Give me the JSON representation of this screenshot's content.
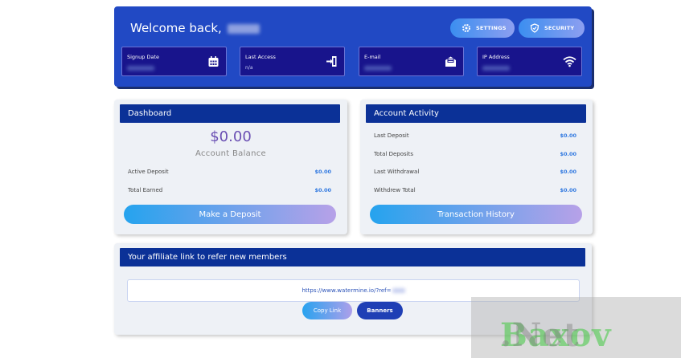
{
  "header": {
    "welcome": "Welcome back,",
    "settings_label": "SETTINGS",
    "security_label": "SECURITY",
    "signup_date_label": "Signup Date",
    "last_access_label": "Last Access",
    "last_access_value": "n/a",
    "email_label": "E-mail",
    "ip_label": "IP Address"
  },
  "dashboard": {
    "title": "Dashboard",
    "balance": "$0.00",
    "balance_label": "Account Balance",
    "rows": [
      {
        "label": "Active Deposit",
        "value": "$0.00"
      },
      {
        "label": "Total Earned",
        "value": "$0.00"
      }
    ],
    "deposit_button": "Make a Deposit"
  },
  "activity": {
    "title": "Account Activity",
    "rows": [
      {
        "label": "Last Deposit",
        "value": "$0.00"
      },
      {
        "label": "Total Deposits",
        "value": "$0.00"
      },
      {
        "label": "Last Withdrawal",
        "value": "$0.00"
      },
      {
        "label": "Withdrew Total",
        "value": "$0.00"
      }
    ],
    "history_button": "Transaction History"
  },
  "affiliate": {
    "title": "Your affiliate link to refer new members",
    "link": "https://www.watermine.io/?ref=",
    "copy_button": "Copy Link",
    "banners_button": "Banners"
  },
  "watermark": {
    "part1": "Baxov",
    "part2": ".Net"
  },
  "colors": {
    "header_bg": "#2149c4",
    "card_title_bg": "#0b3197",
    "value_blue": "#3179e0",
    "balance_purple": "#6a4fb3"
  }
}
